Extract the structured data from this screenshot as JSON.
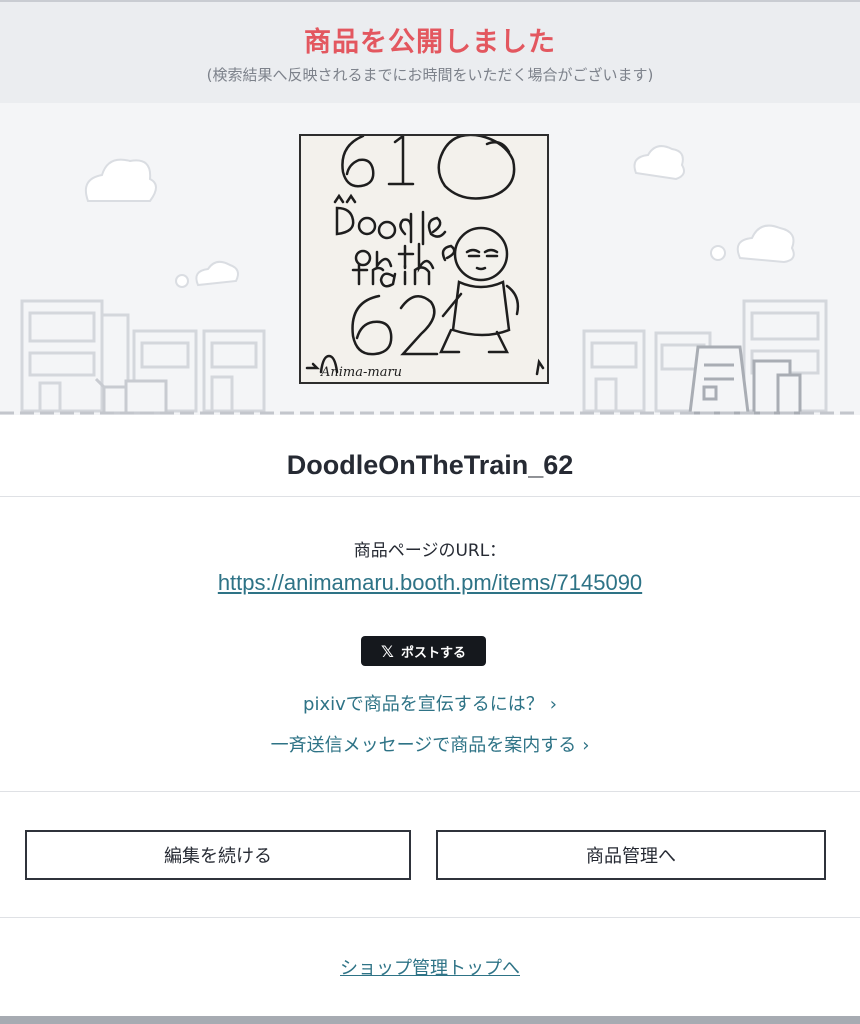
{
  "header": {
    "title": "商品を公開しました",
    "subtitle": "(検索結果へ反映されるまでにお時間をいただく場合がございます)"
  },
  "thumbnail": {
    "number_top": "61",
    "title_line1": "Doodle",
    "title_line2": "on the",
    "title_line3": "train",
    "number_main": "62",
    "signature": "Anima-maru"
  },
  "product": {
    "name": "DoodleOnTheTrain_62"
  },
  "url_section": {
    "label": "商品ページのURL：",
    "url": "https://animamaru.booth.pm/items/7145090"
  },
  "share": {
    "x_icon": "x-logo-icon",
    "post_label": "ポストする"
  },
  "promo_links": {
    "pixiv": "pixivで商品を宣伝するには？",
    "broadcast": "一斉送信メッセージで商品を案内する"
  },
  "buttons": {
    "continue_edit": "編集を続ける",
    "manage_items": "商品管理へ"
  },
  "footer": {
    "shop_top": "ショップ管理トップへ"
  },
  "colors": {
    "title_red": "#e3575f",
    "link_teal": "#2e7386",
    "header_bg": "#ebedf0"
  }
}
